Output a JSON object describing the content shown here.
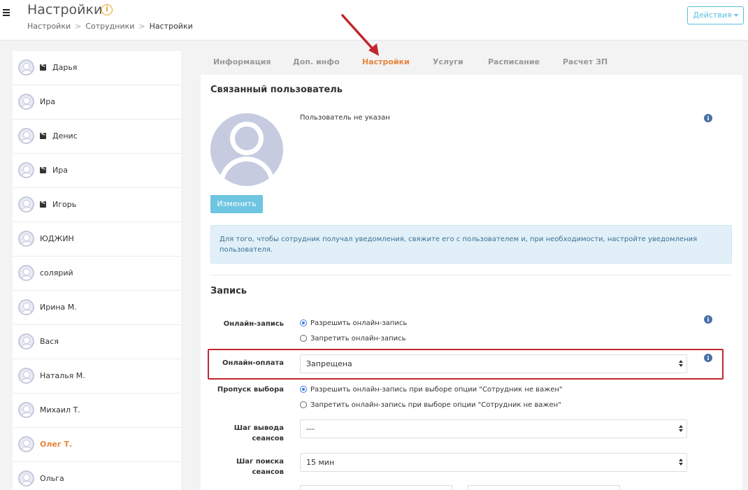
{
  "header": {
    "title": "Настройки",
    "breadcrumb": [
      "Настройки",
      "Сотрудники",
      "Настройки"
    ],
    "actions_label": "Действия"
  },
  "employees": [
    {
      "name": "Дарья",
      "shared": true,
      "active": false
    },
    {
      "name": "Ира",
      "shared": false,
      "active": false
    },
    {
      "name": "Денис",
      "shared": true,
      "active": false
    },
    {
      "name": "Ира",
      "shared": true,
      "active": false
    },
    {
      "name": "Игорь",
      "shared": true,
      "active": false
    },
    {
      "name": "ЮДЖИН",
      "shared": false,
      "active": false
    },
    {
      "name": "солярий",
      "shared": false,
      "active": false
    },
    {
      "name": "Ирина М.",
      "shared": false,
      "active": false
    },
    {
      "name": "Вася",
      "shared": false,
      "active": false
    },
    {
      "name": "Наталья М.",
      "shared": false,
      "active": false
    },
    {
      "name": "Михаил Т.",
      "shared": false,
      "active": false
    },
    {
      "name": "Олег Т.",
      "shared": false,
      "active": true
    },
    {
      "name": "Ольга",
      "shared": false,
      "active": false
    }
  ],
  "tabs": [
    {
      "label": "Информация",
      "active": false
    },
    {
      "label": "Доп. инфо",
      "active": false
    },
    {
      "label": "Настройки",
      "active": true
    },
    {
      "label": "Услуги",
      "active": false
    },
    {
      "label": "Расписание",
      "active": false
    },
    {
      "label": "Расчет ЗП",
      "active": false
    }
  ],
  "linked_user": {
    "title": "Связанный пользователь",
    "status": "Пользователь не указан",
    "change_label": "Изменить",
    "alert": "Для того, чтобы сотрудник получал уведомления, свяжите его с пользователем и, при необходимости, настройте уведомления пользователя."
  },
  "booking": {
    "title": "Запись",
    "online_booking": {
      "label": "Онлайн-запись",
      "options": [
        "Разрешить онлайн-запись",
        "Запретить онлайн-запись"
      ],
      "selected": 0
    },
    "online_payment": {
      "label": "Онлайн-оплата",
      "value": "Запрещена"
    },
    "skip_choice": {
      "label": "Пропуск выбора",
      "options": [
        "Разрешить онлайн-запись при выборе опции \"Сотрудник не важен\"",
        "Запретить онлайн-запись при выборе опции \"Сотрудник не важен\""
      ],
      "selected": 0
    },
    "output_step": {
      "label_line1": "Шаг вывода",
      "label_line2": "сеансов",
      "value": "---"
    },
    "search_step": {
      "label_line1": "Шаг поиска",
      "label_line2": "сеансов",
      "value": "15 мин"
    }
  },
  "colors": {
    "accent": "#e8833a",
    "info": "#5bc0de",
    "highlight": "#c0272d"
  }
}
